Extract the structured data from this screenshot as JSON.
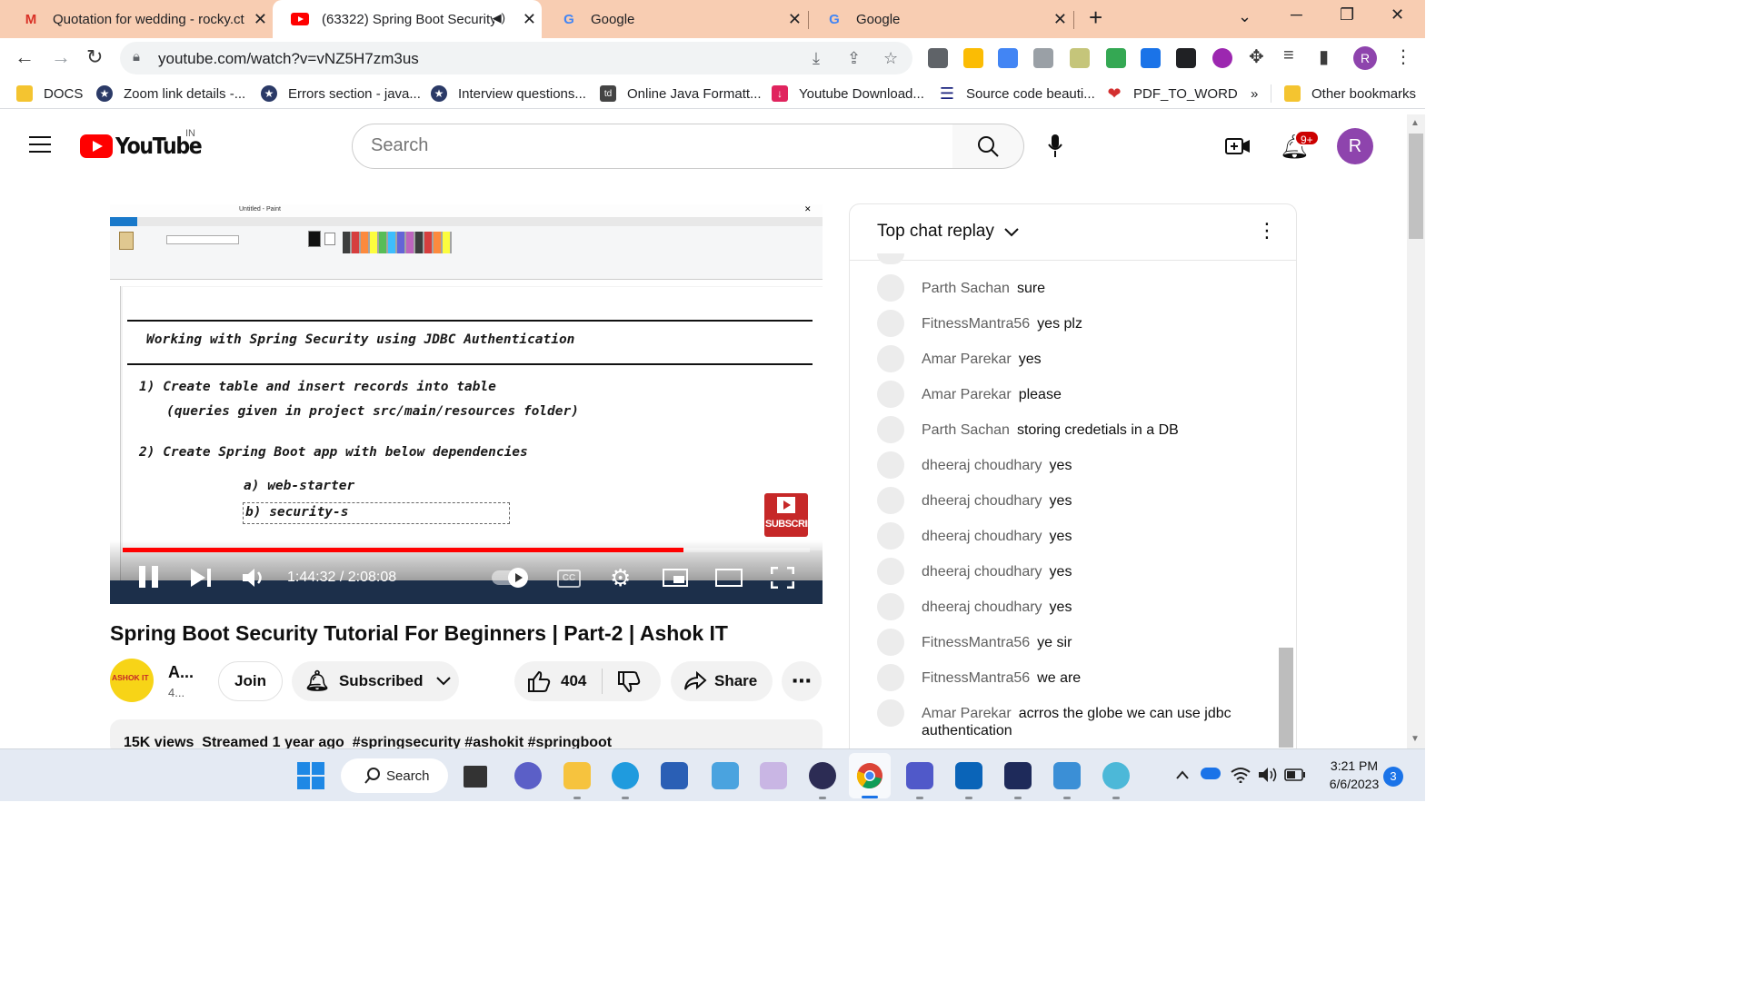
{
  "browser": {
    "tabs": [
      {
        "title": "Quotation for wedding - rocky.ct",
        "icon": "gmail-icon"
      },
      {
        "title": "(63322) Spring Boot Security",
        "icon": "youtube-icon",
        "active": true
      },
      {
        "title": "Google",
        "icon": "google-icon"
      },
      {
        "title": "Google",
        "icon": "google-icon"
      }
    ],
    "url": "youtube.com/watch?v=vNZ5H7zm3us",
    "profile_initial": "R",
    "bookmarks": [
      {
        "label": "DOCS",
        "color": "#f4c430"
      },
      {
        "label": "Zoom link details -...",
        "color": "#2b3a67"
      },
      {
        "label": "Errors section - java...",
        "color": "#2b3a67"
      },
      {
        "label": "Interview questions...",
        "color": "#2b3a67"
      },
      {
        "label": "Online Java Formatt...",
        "color": "#444"
      },
      {
        "label": "Youtube Download...",
        "color": "#e0245e"
      },
      {
        "label": "Source code beauti...",
        "color": "#1a237e"
      },
      {
        "label": "PDF_TO_WORD",
        "color": "#d32f2f"
      }
    ],
    "bookmarks_more": "»",
    "other_bookmarks": "Other bookmarks"
  },
  "youtube": {
    "logo_text": "YouTube",
    "country": "IN",
    "search_placeholder": "Search",
    "notification_count": "9+",
    "avatar_initial": "R"
  },
  "video": {
    "paint_title": "Untitled - Paint",
    "doc_lines": [
      "Working with Spring Security using JDBC Authentication",
      "1) Create table and insert records into table",
      "(queries given in project src/main/resources folder)",
      "2) Create Spring Boot app with below dependencies",
      "a) web-starter",
      "b) security-s"
    ],
    "subscribe_label": "SUBSCRIBE",
    "time_current": "1:44:32",
    "time_total": "2:08:08",
    "progress": 0.816,
    "title": "Spring Boot Security Tutorial For Beginners | Part-2 | Ashok IT",
    "channel_short": "A...",
    "subs_short": "4...",
    "channel_logo_text": "ASHOK IT",
    "join_label": "Join",
    "subscribed_label": "Subscribed",
    "likes": "404",
    "share_label": "Share",
    "description_line": "15K views  Streamed 1 year ago  #springsecurity #ashokit #springboot"
  },
  "chat": {
    "header": "Top chat replay",
    "messages": [
      {
        "author": "Parth Sachan",
        "text": "sure"
      },
      {
        "author": "FitnessMantra56",
        "text": "yes plz"
      },
      {
        "author": "Amar Parekar",
        "text": "yes"
      },
      {
        "author": "Amar Parekar",
        "text": "please"
      },
      {
        "author": "Parth Sachan",
        "text": "storing credetials in a DB"
      },
      {
        "author": "dheeraj choudhary",
        "text": "yes"
      },
      {
        "author": "dheeraj choudhary",
        "text": "yes"
      },
      {
        "author": "dheeraj choudhary",
        "text": "yes"
      },
      {
        "author": "dheeraj choudhary",
        "text": "yes"
      },
      {
        "author": "dheeraj choudhary",
        "text": "yes"
      },
      {
        "author": "FitnessMantra56",
        "text": "ye sir"
      },
      {
        "author": "FitnessMantra56",
        "text": "we are"
      },
      {
        "author": "Amar Parekar",
        "text": "acrros the globe we can use jdbc authentication"
      }
    ]
  },
  "taskbar": {
    "search_label": "Search",
    "time": "3:21 PM",
    "date": "6/6/2023",
    "notifications": "3"
  }
}
